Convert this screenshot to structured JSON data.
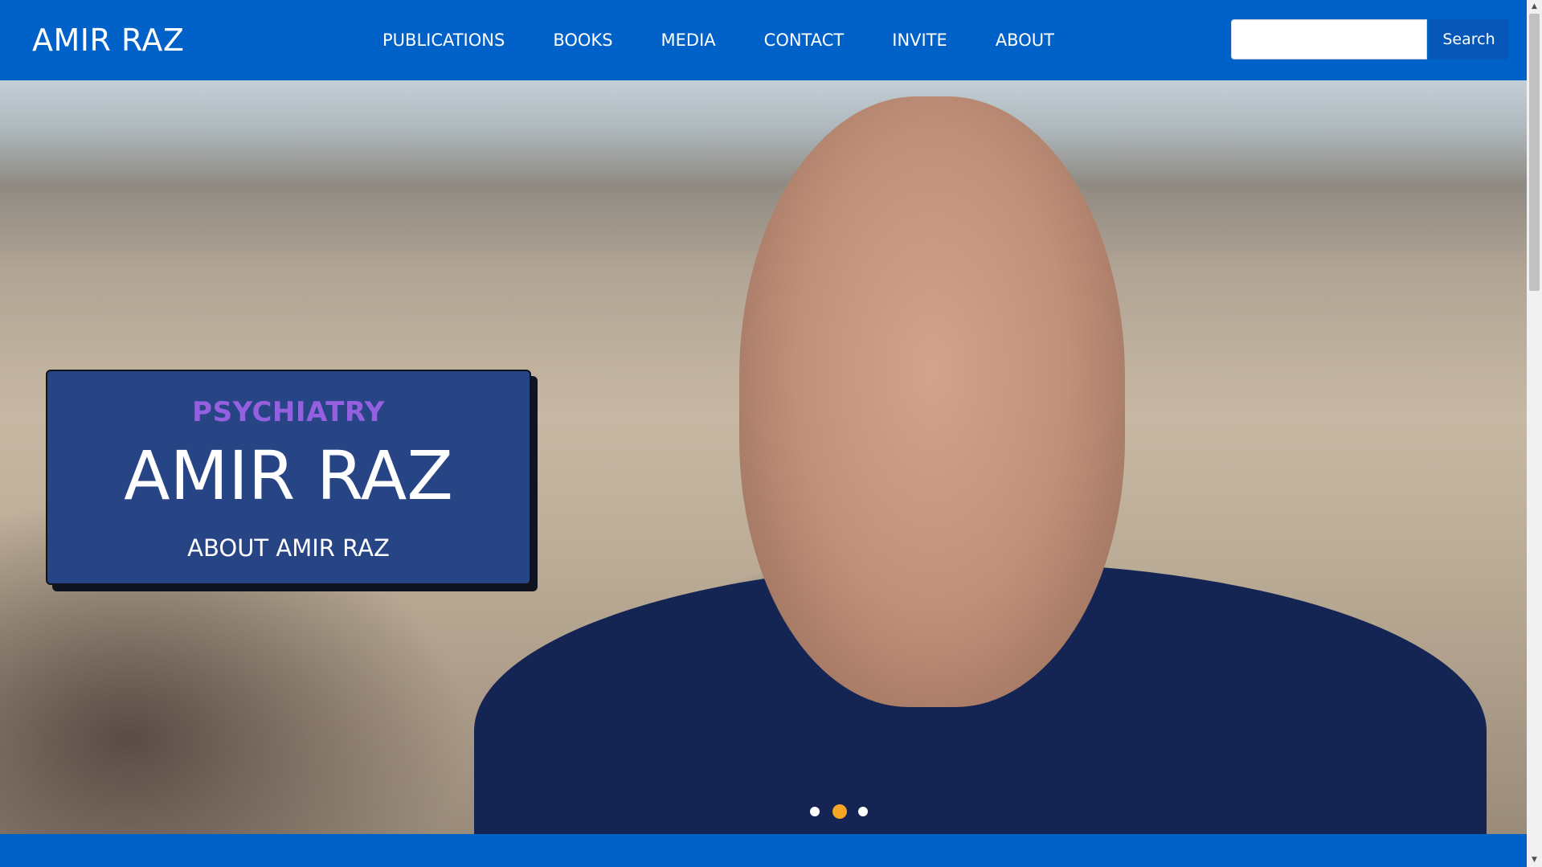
{
  "header": {
    "brand": "AMIR RAZ",
    "nav": [
      "PUBLICATIONS",
      "BOOKS",
      "MEDIA",
      "CONTACT",
      "INVITE",
      "ABOUT"
    ],
    "search": {
      "placeholder": "",
      "button_label": "Search"
    }
  },
  "hero": {
    "kicker": "PSYCHIATRY",
    "title": "AMIR RAZ",
    "link": "ABOUT AMIR RAZ",
    "scroll_down_icon": "arrow-down-icon",
    "scroll_down_glyph": "↓",
    "carousel": {
      "slides": 3,
      "active_index": 1
    }
  },
  "colors": {
    "primary": "#0062c9",
    "card": "#274585",
    "kicker": "#9460e0",
    "dot_active": "#f5a623"
  }
}
